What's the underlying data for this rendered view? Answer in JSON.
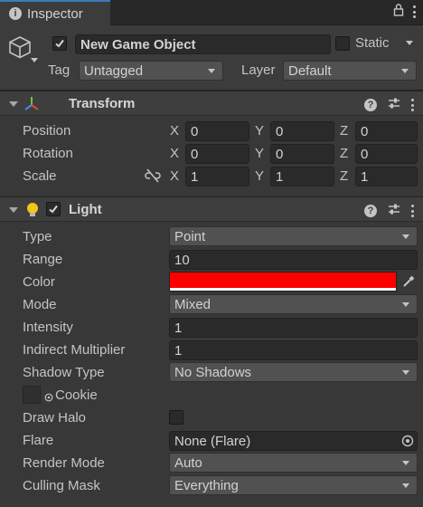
{
  "tab": {
    "title": "Inspector"
  },
  "gameobject": {
    "name": "New Game Object",
    "static_label": "Static",
    "tag_label": "Tag",
    "tag_value": "Untagged",
    "layer_label": "Layer",
    "layer_value": "Default"
  },
  "transform": {
    "title": "Transform",
    "rows": [
      {
        "label": "Position",
        "x": "0",
        "y": "0",
        "z": "0"
      },
      {
        "label": "Rotation",
        "x": "0",
        "y": "0",
        "z": "0"
      },
      {
        "label": "Scale",
        "x": "1",
        "y": "1",
        "z": "1"
      }
    ],
    "axis": {
      "x": "X",
      "y": "Y",
      "z": "Z"
    }
  },
  "light": {
    "title": "Light",
    "type_label": "Type",
    "type_value": "Point",
    "range_label": "Range",
    "range_value": "10",
    "color_label": "Color",
    "color_value": "#ff0000",
    "mode_label": "Mode",
    "mode_value": "Mixed",
    "intensity_label": "Intensity",
    "intensity_value": "1",
    "indirect_label": "Indirect Multiplier",
    "indirect_value": "1",
    "shadow_label": "Shadow Type",
    "shadow_value": "No Shadows",
    "cookie_label": "Cookie",
    "halo_label": "Draw Halo",
    "flare_label": "Flare",
    "flare_value": "None (Flare)",
    "render_label": "Render Mode",
    "render_value": "Auto",
    "culling_label": "Culling Mask",
    "culling_value": "Everything"
  }
}
